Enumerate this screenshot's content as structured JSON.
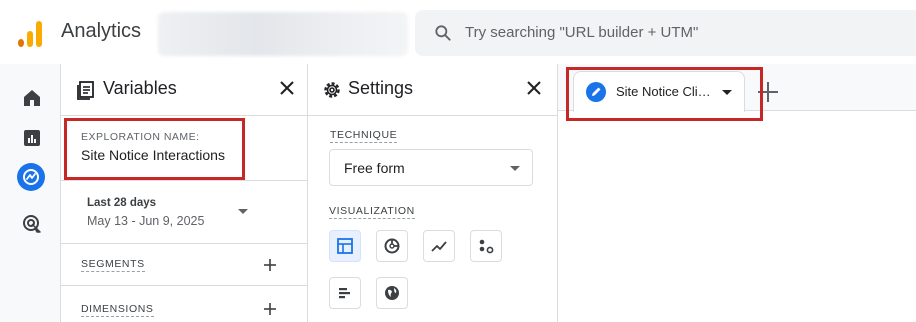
{
  "app": {
    "title": "Analytics",
    "brand_color": "#f9ab00",
    "accent_color": "#1a73e8"
  },
  "search": {
    "placeholder": "Try searching \"URL builder + UTM\""
  },
  "rail": {
    "items": [
      {
        "icon": "home-icon"
      },
      {
        "icon": "reports-icon"
      },
      {
        "icon": "explore-icon",
        "active": true
      },
      {
        "icon": "advertising-icon"
      }
    ]
  },
  "variables": {
    "title": "Variables",
    "exploration_name_label": "EXPLORATION NAME:",
    "exploration_name_value": "Site Notice Interactions",
    "date_range_label": "Last 28 days",
    "date_range_value": "May 13 - Jun 9, 2025",
    "segments_label": "SEGMENTS",
    "dimensions_label": "DIMENSIONS"
  },
  "settings": {
    "title": "Settings",
    "technique_label": "TECHNIQUE",
    "technique_value": "Free form",
    "visualization_label": "VISUALIZATION",
    "visualizations": [
      "table-icon",
      "donut-chart-icon",
      "line-chart-icon",
      "scatter-plot-icon",
      "bar-chart-icon",
      "geo-map-icon"
    ]
  },
  "tabs": {
    "items": [
      {
        "label": "Site Notice Cli…",
        "icon": "pencil-icon"
      }
    ],
    "add_icon": "plus-icon"
  },
  "highlight_color": "#c62828"
}
